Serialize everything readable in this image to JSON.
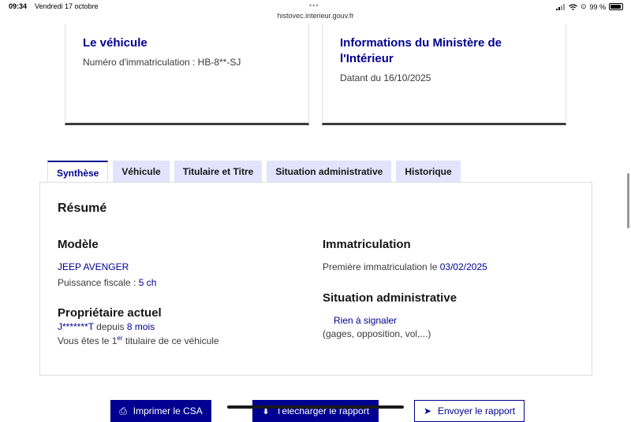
{
  "statusbar": {
    "time": "09:34",
    "date": "Vendredi 17 octobre",
    "url": "histovec.interieur.gouv.fr",
    "dots": "•••",
    "battery": "99 %",
    "wifi_icon": "wifi-icon",
    "signal_icon": "signal-icon"
  },
  "card_vehicle": {
    "title": "Le véhicule",
    "plate_line": "Numéro d'immatriculation : HB-8**-SJ"
  },
  "card_ministry": {
    "title": "Informations du Ministère de l'Intérieur",
    "date_line": "Datant du 16/10/2025"
  },
  "tabs": [
    {
      "label": "Synthèse",
      "active": true
    },
    {
      "label": "Véhicule",
      "active": false
    },
    {
      "label": "Titulaire et Titre",
      "active": false
    },
    {
      "label": "Situation administrative",
      "active": false
    },
    {
      "label": "Historique",
      "active": false
    }
  ],
  "panel": {
    "title": "Résumé",
    "model_heading": "Modèle",
    "model_name": "JEEP AVENGER",
    "fiscal_label": "Puissance fiscale :",
    "fiscal_value": "5 ch",
    "owner_heading": "Propriétaire actuel",
    "owner_name": "J*******T",
    "owner_since_label": "depuis",
    "owner_since_value": "8 mois",
    "owner_rank_pre": "Vous êtes le 1",
    "owner_rank_sup": "er",
    "owner_rank_post": "titulaire de ce véhicule",
    "immat_heading": "Immatriculation",
    "immat_label": "Première immatriculation le",
    "immat_date": "03/02/2025",
    "situation_heading": "Situation administrative",
    "situation_value": "Rien à signaler",
    "situation_note": "(gages, opposition, vol,...)"
  },
  "actions": {
    "print_label": "Imprimer le CSA",
    "download_label": "Télécharger le rapport",
    "send_label": "Envoyer le rapport"
  },
  "colors": {
    "primary": "#000091",
    "tab_bg": "#e3e3fd",
    "text": "#161616",
    "muted": "#3a3a3a"
  }
}
